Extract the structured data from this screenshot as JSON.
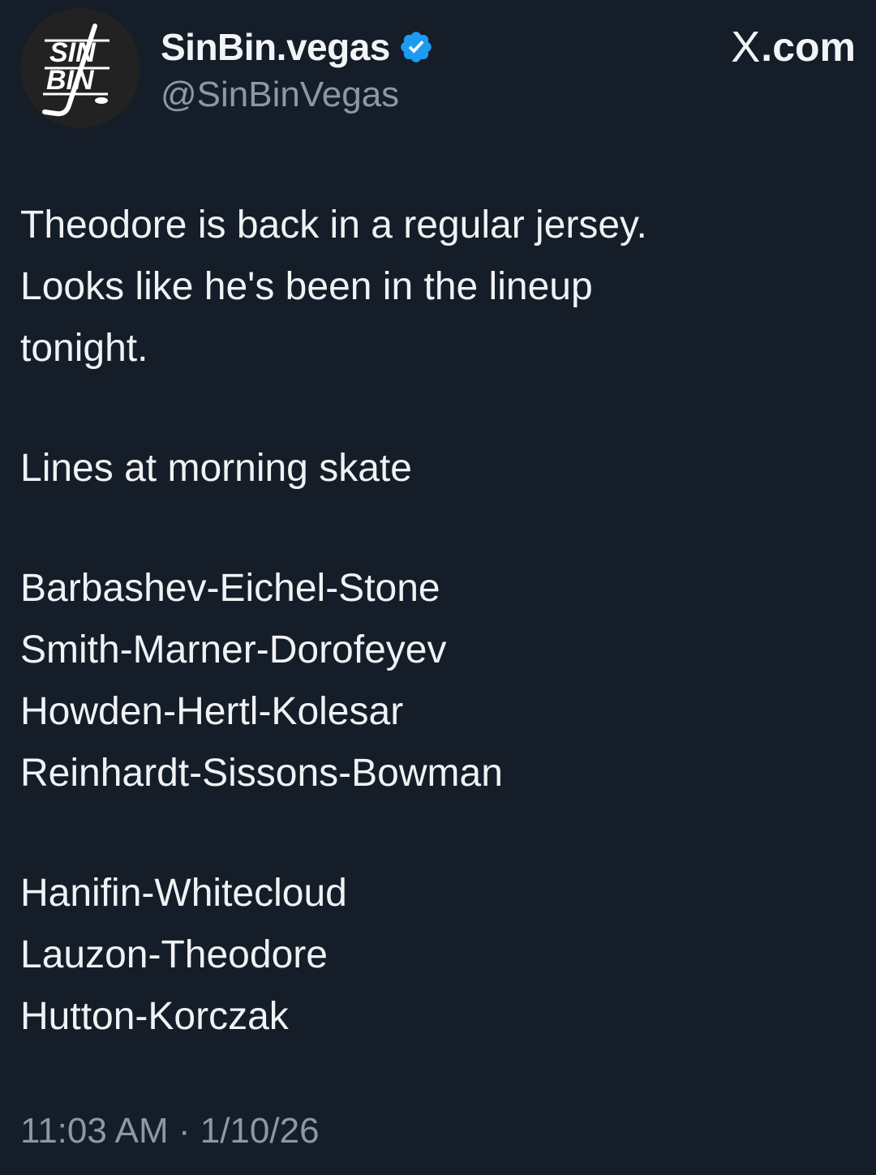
{
  "tweet": {
    "display_name": "SinBin.vegas",
    "handle": "@SinBinVegas",
    "verified": true,
    "avatar_icon": "sinbin-logo-icon",
    "avatar_logo_text": [
      "SIN",
      "BIN"
    ],
    "source_x": "X",
    "source_domain": ".com",
    "paragraph1": [
      "Theodore is back in a regular jersey.",
      "Looks like he's been in the lineup",
      "tonight."
    ],
    "paragraph2": "Lines at morning skate",
    "forward_lines": [
      "Barbashev-Eichel-Stone",
      "Smith-Marner-Dorofeyev",
      "Howden-Hertl-Kolesar",
      "Reinhardt-Sissons-Bowman"
    ],
    "defense_pairs": [
      "Hanifin-Whitecloud",
      "Lauzon-Theodore",
      "Hutton-Korczak"
    ],
    "timestamp": "11:03 AM · 1/10/26"
  },
  "colors": {
    "background": "#151d29",
    "text": "#e7e9ea",
    "secondary_text": "#8b98a5",
    "verified_badge": "#1d9bf0"
  }
}
